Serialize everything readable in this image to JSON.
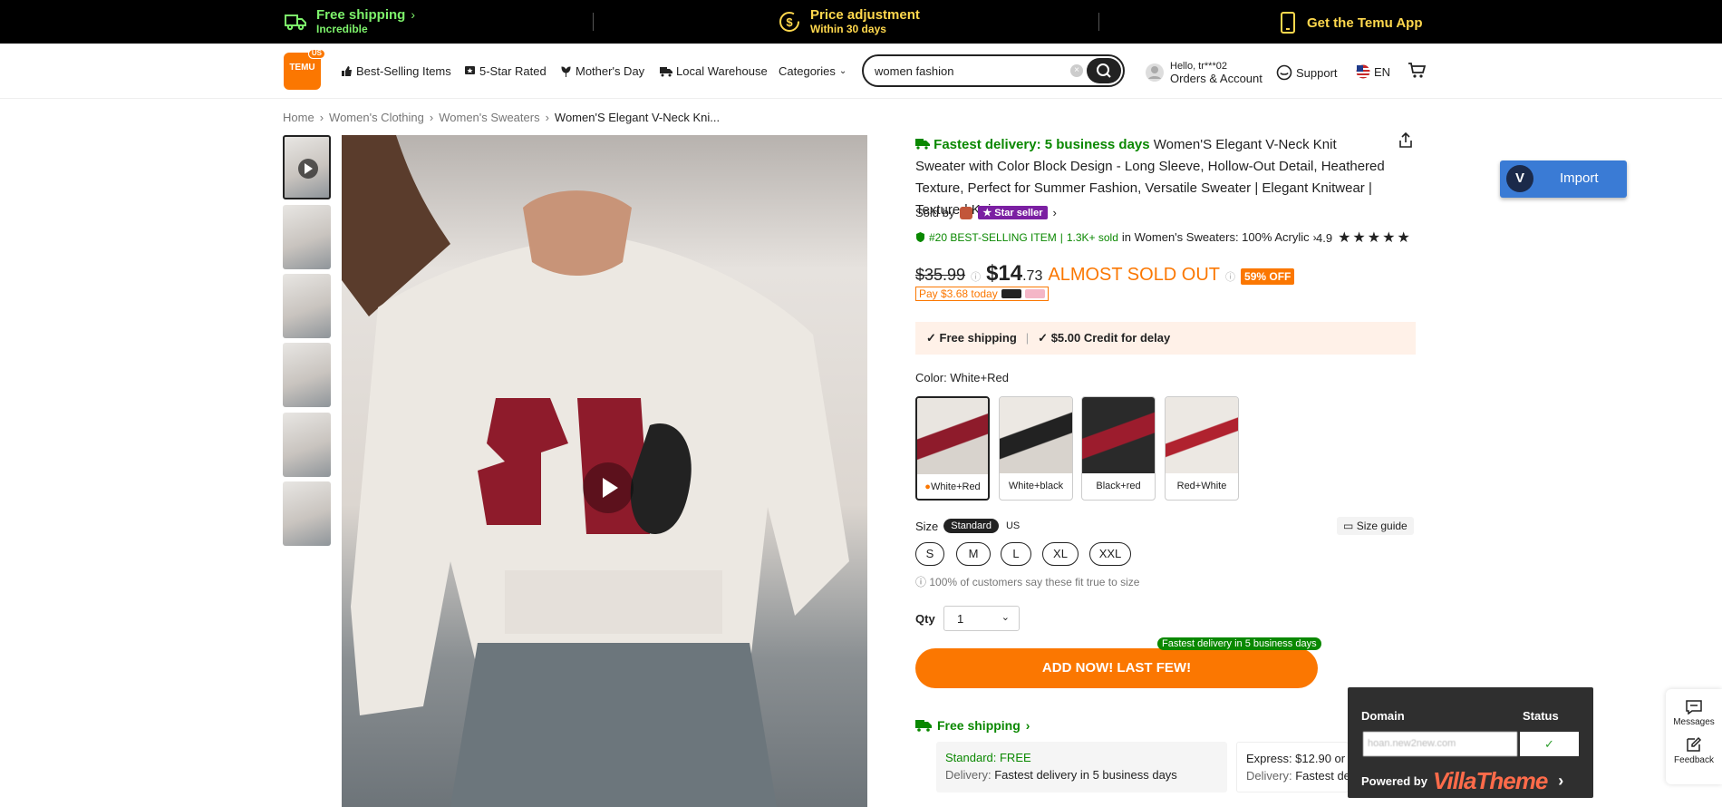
{
  "topbar": {
    "free_shipping": "Free shipping",
    "free_shipping_sub": "Incredible",
    "price_adjust": "Price adjustment",
    "price_adjust_sub": "Within 30 days",
    "get_app": "Get the Temu App"
  },
  "nav": {
    "logo_text": "TEMU",
    "logo_badge": "US",
    "links": [
      "Best-Selling Items",
      "5-Star Rated",
      "Mother's Day",
      "Local Warehouse",
      "Categories"
    ],
    "search_value": "women fashion",
    "hello": "Hello, tr***02",
    "orders": "Orders & Account",
    "support": "Support",
    "lang": "EN"
  },
  "breadcrumb": [
    "Home",
    "Women's Clothing",
    "Women's Sweaters",
    "Women'S Elegant V-Neck Kni..."
  ],
  "product": {
    "fast_delivery": "Fastest delivery: 5 business days",
    "title": "Women'S Elegant V-Neck Knit Sweater with Color Block Design - Long Sleeve, Hollow-Out Detail, Heathered Texture, Perfect for Summer Fashion, Versatile Sweater | Elegant Knitwear | Textured Kni",
    "sold_by": "Sold by",
    "star_seller": "★ Star seller",
    "rank": "#20 BEST-SELLING ITEM",
    "sold": "1.3K+ sold",
    "rank_category": "in Women's Sweaters: 100% Acrylic",
    "rating": "4.9",
    "stars": "★★★★★",
    "old_price": "$35.99",
    "price_main": "$14",
    "price_cents": ".73",
    "almost": "ALMOST SOLD OUT",
    "off": "59% OFF",
    "pay_today": "Pay $3.68 today",
    "free_shipping": "Free shipping",
    "credit": "$5.00 Credit for delay",
    "color_label": "Color: White+Red",
    "colors": [
      "White+Red",
      "White+black",
      "Black+red",
      "Red+White"
    ],
    "size_label": "Size",
    "size_std": "Standard",
    "size_us": "US",
    "size_guide": "Size guide",
    "sizes": [
      "S",
      "M",
      "L",
      "XL",
      "XXL"
    ],
    "fit_note": "100% of customers say these fit true to size",
    "qty_label": "Qty",
    "qty_value": "1",
    "add_button": "ADD NOW! LAST FEW!",
    "fast_badge": "Fastest delivery in 5 business days",
    "free_shipping_link": "Free shipping",
    "standard_title": "Standard: FREE",
    "standard_delivery_label": "Delivery:",
    "standard_delivery": "Fastest delivery in 5 business days",
    "express_title": "Express: $12.90 or F",
    "express_delivery_label": "Delivery:",
    "express_delivery": "Fastest del"
  },
  "import_button": "Import",
  "villa": {
    "domain": "Domain",
    "status": "Status",
    "domain_value": "hoan.new2new.com",
    "powered": "Powered by",
    "brand": "VillaTheme"
  },
  "side": {
    "messages": "Messages",
    "feedback": "Feedback"
  },
  "colors": {
    "accent": "#fb7701",
    "green": "#0a8800",
    "topbar_green": "#7df26b",
    "topbar_gold": "#ffd84d",
    "import_blue": "#3a7bd5"
  }
}
